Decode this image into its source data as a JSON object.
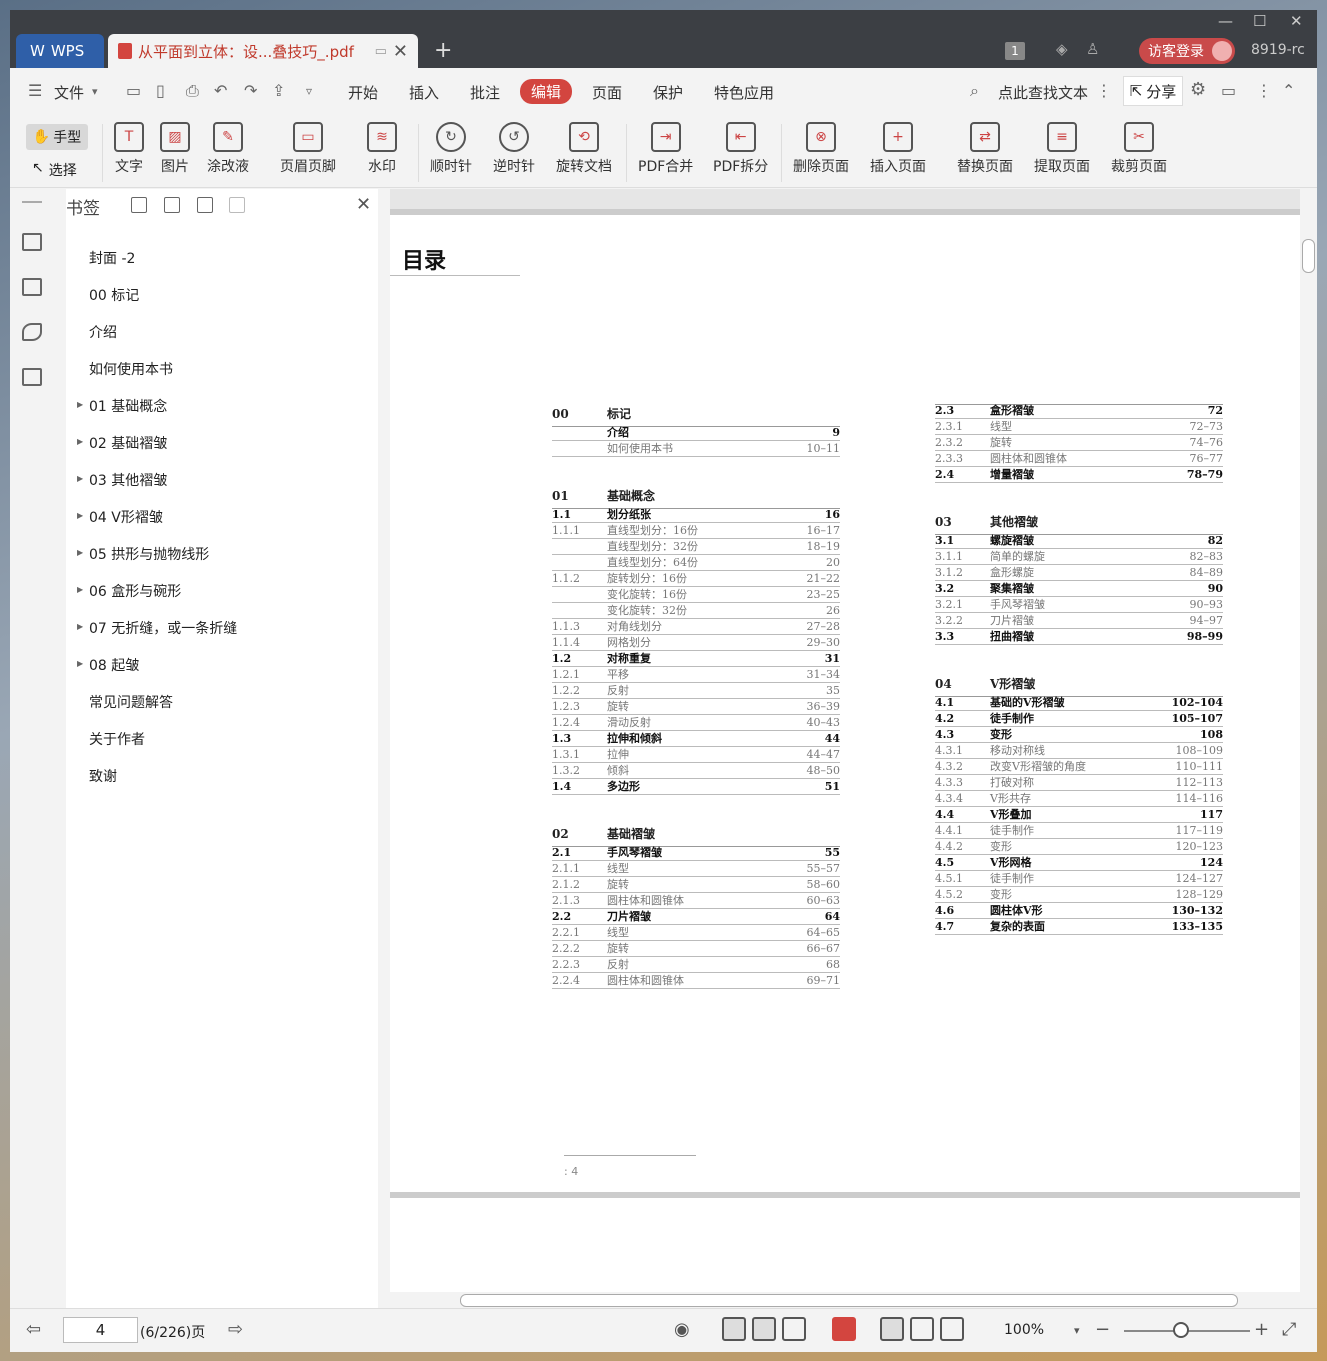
{
  "titlebar": {
    "wps_label": "WPS",
    "doc_tab_title": "从平面到立体：设...叠技巧_.pdf",
    "badge": "1",
    "login_label": "访客登录",
    "user_id": "8919-rc"
  },
  "menubar": {
    "file": "文件",
    "items": [
      "开始",
      "插入",
      "批注",
      "编辑",
      "页面",
      "保护",
      "特色应用"
    ],
    "active": "编辑",
    "search_placeholder": "点此查找文本",
    "share": "分享"
  },
  "ribbon": {
    "hand": "手型",
    "select": "选择",
    "buttons": [
      "文字",
      "图片",
      "涂改液",
      "页眉页脚",
      "水印",
      "顺时针",
      "逆时针",
      "旋转文档",
      "PDF合并",
      "PDF拆分",
      "删除页面",
      "插入页面",
      "替换页面",
      "提取页面",
      "裁剪页面"
    ]
  },
  "bookmarks": {
    "title": "书签",
    "items": [
      {
        "label": "封面 -2",
        "expandable": false
      },
      {
        "label": "00 标记",
        "expandable": false
      },
      {
        "label": "介绍",
        "expandable": false
      },
      {
        "label": "如何使用本书",
        "expandable": false
      },
      {
        "label": "01 基础概念",
        "expandable": true
      },
      {
        "label": "02 基础褶皱",
        "expandable": true
      },
      {
        "label": "03 其他褶皱",
        "expandable": true
      },
      {
        "label": "04 V形褶皱",
        "expandable": true
      },
      {
        "label": "05 拱形与抛物线形",
        "expandable": true
      },
      {
        "label": "06 盒形与碗形",
        "expandable": true
      },
      {
        "label": "07 无折缝，或一条折缝",
        "expandable": true
      },
      {
        "label": "08 起皱",
        "expandable": true
      },
      {
        "label": "常见问题解答",
        "expandable": false
      },
      {
        "label": "关于作者",
        "expandable": false
      },
      {
        "label": "致谢",
        "expandable": false
      }
    ]
  },
  "page": {
    "title": "目录",
    "footer": ": 4",
    "left_col": [
      {
        "sec_num": "00",
        "sec_title": "标记",
        "rows": [
          {
            "n": "",
            "t": "介绍",
            "p": "9",
            "b": true
          },
          {
            "n": "",
            "t": "如何使用本书",
            "p": "10–11",
            "b": false
          }
        ]
      },
      {
        "sec_num": "01",
        "sec_title": "基础概念",
        "rows": [
          {
            "n": "1.1",
            "t": "划分纸张",
            "p": "16",
            "b": true
          },
          {
            "n": "1.1.1",
            "t": "直线型划分：16份",
            "p": "16–17",
            "b": false
          },
          {
            "n": "",
            "t": "直线型划分：32份",
            "p": "18–19",
            "b": false
          },
          {
            "n": "",
            "t": "直线型划分：64份",
            "p": "20",
            "b": false
          },
          {
            "n": "1.1.2",
            "t": "旋转划分：16份",
            "p": "21–22",
            "b": false
          },
          {
            "n": "",
            "t": "变化旋转：16份",
            "p": "23–25",
            "b": false
          },
          {
            "n": "",
            "t": "变化旋转：32份",
            "p": "26",
            "b": false
          },
          {
            "n": "1.1.3",
            "t": "对角线划分",
            "p": "27–28",
            "b": false
          },
          {
            "n": "1.1.4",
            "t": "网格划分",
            "p": "29–30",
            "b": false
          },
          {
            "n": "1.2",
            "t": "对称重复",
            "p": "31",
            "b": true
          },
          {
            "n": "1.2.1",
            "t": "平移",
            "p": "31–34",
            "b": false
          },
          {
            "n": "1.2.2",
            "t": "反射",
            "p": "35",
            "b": false
          },
          {
            "n": "1.2.3",
            "t": "旋转",
            "p": "36–39",
            "b": false
          },
          {
            "n": "1.2.4",
            "t": "滑动反射",
            "p": "40–43",
            "b": false
          },
          {
            "n": "1.3",
            "t": "拉伸和倾斜",
            "p": "44",
            "b": true
          },
          {
            "n": "1.3.1",
            "t": "拉伸",
            "p": "44–47",
            "b": false
          },
          {
            "n": "1.3.2",
            "t": "倾斜",
            "p": "48–50",
            "b": false
          },
          {
            "n": "1.4",
            "t": "多边形",
            "p": "51",
            "b": true
          }
        ]
      },
      {
        "sec_num": "02",
        "sec_title": "基础褶皱",
        "rows": [
          {
            "n": "2.1",
            "t": "手风琴褶皱",
            "p": "55",
            "b": true
          },
          {
            "n": "2.1.1",
            "t": "线型",
            "p": "55–57",
            "b": false
          },
          {
            "n": "2.1.2",
            "t": "旋转",
            "p": "58–60",
            "b": false
          },
          {
            "n": "2.1.3",
            "t": "圆柱体和圆锥体",
            "p": "60–63",
            "b": false
          },
          {
            "n": "2.2",
            "t": "刀片褶皱",
            "p": "64",
            "b": true
          },
          {
            "n": "2.2.1",
            "t": "线型",
            "p": "64–65",
            "b": false
          },
          {
            "n": "2.2.2",
            "t": "旋转",
            "p": "66–67",
            "b": false
          },
          {
            "n": "2.2.3",
            "t": "反射",
            "p": "68",
            "b": false
          },
          {
            "n": "2.2.4",
            "t": "圆柱体和圆锥体",
            "p": "69–71",
            "b": false
          }
        ]
      }
    ],
    "right_col": [
      {
        "sec_num": "",
        "sec_title": "",
        "rows": [
          {
            "n": "2.3",
            "t": "盒形褶皱",
            "p": "72",
            "b": true
          },
          {
            "n": "2.3.1",
            "t": "线型",
            "p": "72–73",
            "b": false
          },
          {
            "n": "2.3.2",
            "t": "旋转",
            "p": "74–76",
            "b": false
          },
          {
            "n": "2.3.3",
            "t": "圆柱体和圆锥体",
            "p": "76–77",
            "b": false
          },
          {
            "n": "2.4",
            "t": "增量褶皱",
            "p": "78–79",
            "b": true
          }
        ]
      },
      {
        "sec_num": "03",
        "sec_title": "其他褶皱",
        "rows": [
          {
            "n": "3.1",
            "t": "螺旋褶皱",
            "p": "82",
            "b": true
          },
          {
            "n": "3.1.1",
            "t": "简单的螺旋",
            "p": "82–83",
            "b": false
          },
          {
            "n": "3.1.2",
            "t": "盒形螺旋",
            "p": "84–89",
            "b": false
          },
          {
            "n": "3.2",
            "t": "聚集褶皱",
            "p": "90",
            "b": true
          },
          {
            "n": "3.2.1",
            "t": "手风琴褶皱",
            "p": "90–93",
            "b": false
          },
          {
            "n": "3.2.2",
            "t": "刀片褶皱",
            "p": "94–97",
            "b": false
          },
          {
            "n": "3.3",
            "t": "扭曲褶皱",
            "p": "98–99",
            "b": true
          }
        ]
      },
      {
        "sec_num": "04",
        "sec_title": "V形褶皱",
        "rows": [
          {
            "n": "4.1",
            "t": "基础的V形褶皱",
            "p": "102–104",
            "b": true
          },
          {
            "n": "4.2",
            "t": "徒手制作",
            "p": "105–107",
            "b": true
          },
          {
            "n": "4.3",
            "t": "变形",
            "p": "108",
            "b": true
          },
          {
            "n": "4.3.1",
            "t": "移动对称线",
            "p": "108–109",
            "b": false
          },
          {
            "n": "4.3.2",
            "t": "改变V形褶皱的角度",
            "p": "110–111",
            "b": false
          },
          {
            "n": "4.3.3",
            "t": "打破对称",
            "p": "112–113",
            "b": false
          },
          {
            "n": "4.3.4",
            "t": "V形共存",
            "p": "114–116",
            "b": false
          },
          {
            "n": "4.4",
            "t": "V形叠加",
            "p": "117",
            "b": true
          },
          {
            "n": "4.4.1",
            "t": "徒手制作",
            "p": "117–119",
            "b": false
          },
          {
            "n": "4.4.2",
            "t": "变形",
            "p": "120–123",
            "b": false
          },
          {
            "n": "4.5",
            "t": "V形网格",
            "p": "124",
            "b": true
          },
          {
            "n": "4.5.1",
            "t": "徒手制作",
            "p": "124–127",
            "b": false
          },
          {
            "n": "4.5.2",
            "t": "变形",
            "p": "128–129",
            "b": false
          },
          {
            "n": "4.6",
            "t": "圆柱体V形",
            "p": "130–132",
            "b": true
          },
          {
            "n": "4.7",
            "t": "复杂的表面",
            "p": "133–135",
            "b": true
          }
        ]
      }
    ]
  },
  "statusbar": {
    "page_input": "4",
    "page_total": "(6/226)页",
    "zoom": "100%"
  },
  "colors": {
    "accent": "#d3453f",
    "wps_blue": "#2f5fa8",
    "titlebar": "#3c3f44"
  }
}
